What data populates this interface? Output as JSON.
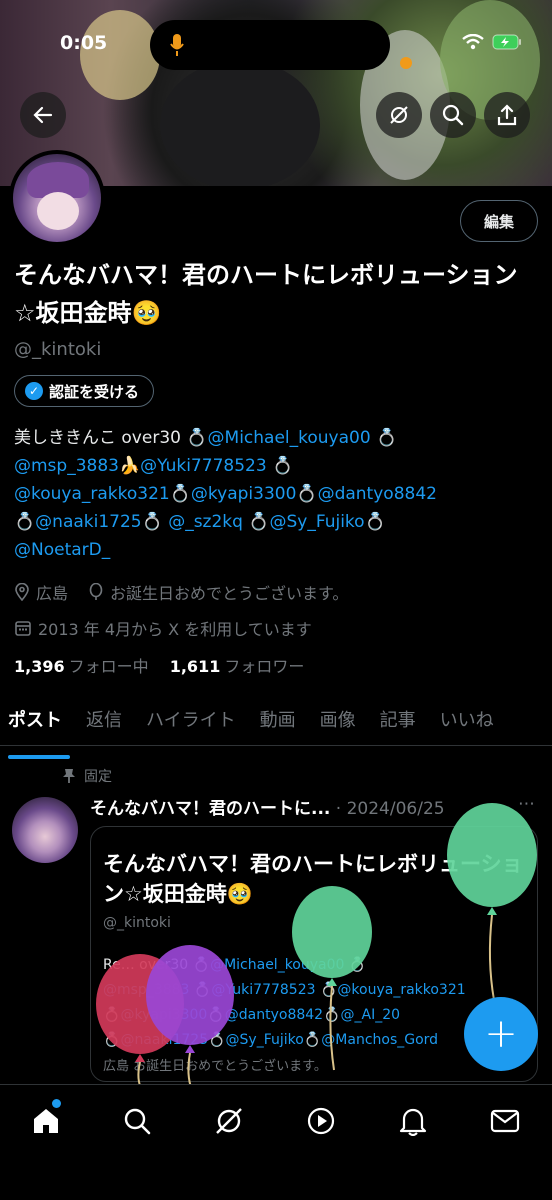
{
  "status_bar": {
    "time": "0:05"
  },
  "profile": {
    "edit_label": "編集",
    "name": "そんなバハマ！君のハートにレボリューション☆坂田金時🥹",
    "handle": "@_kintoki",
    "verify_label": "認証を受ける",
    "bio_lines": [
      [
        {
          "t": "美しききんこ over30 💍",
          "m": false
        },
        {
          "t": "@Michael_kouya00",
          "m": true
        },
        {
          "t": " 💍",
          "m": false
        }
      ],
      [
        {
          "t": "@msp_3883",
          "m": true
        },
        {
          "t": "🍌",
          "m": false
        },
        {
          "t": "@Yuki7778523",
          "m": true
        },
        {
          "t": " 💍",
          "m": false
        }
      ],
      [
        {
          "t": "@kouya_rakko321",
          "m": true
        },
        {
          "t": "💍",
          "m": false
        },
        {
          "t": "@kyapi3300",
          "m": true
        },
        {
          "t": "💍",
          "m": false
        },
        {
          "t": "@dantyo8842",
          "m": true
        }
      ],
      [
        {
          "t": "💍",
          "m": false
        },
        {
          "t": "@naaki1725",
          "m": true
        },
        {
          "t": "💍 ",
          "m": false
        },
        {
          "t": "@_sz2kq",
          "m": true
        },
        {
          "t": " 💍",
          "m": false
        },
        {
          "t": "@Sy_Fujiko",
          "m": true
        },
        {
          "t": "💍",
          "m": false
        }
      ],
      [
        {
          "t": "@NoetarD_",
          "m": true
        }
      ]
    ],
    "location": "広島",
    "birthday": "お誕生日おめでとうございます。",
    "joined": "2013 年 4月から X を利用しています",
    "following_count": "1,396",
    "following_label": "フォロー中",
    "followers_count": "1,611",
    "followers_label": "フォロワー"
  },
  "tabs": [
    {
      "label": "ポスト",
      "active": true
    },
    {
      "label": "返信",
      "active": false
    },
    {
      "label": "ハイライト",
      "active": false
    },
    {
      "label": "動画",
      "active": false
    },
    {
      "label": "画像",
      "active": false
    },
    {
      "label": "記事",
      "active": false
    },
    {
      "label": "いいね",
      "active": false
    }
  ],
  "pinned_post": {
    "pinned_label": "固定",
    "author": "そんなバハマ！君のハートに...",
    "date": "2024/06/25",
    "more": "⋯",
    "card": {
      "title": "そんなバハマ！君のハートにレボリューション☆坂田金時🥹",
      "handle": "@_kintoki",
      "bio_lines": [
        [
          {
            "t": "Re… over30 💍",
            "m": false
          },
          {
            "t": "@Michael_kouya00",
            "m": true
          },
          {
            "t": " 💍",
            "m": false
          }
        ],
        [
          {
            "t": "@msp_3883",
            "m": true
          },
          {
            "t": " 💍",
            "m": false
          },
          {
            "t": "@Yuki7778523",
            "m": true
          },
          {
            "t": " 💍",
            "m": false
          },
          {
            "t": "@kouya_rakko321",
            "m": true
          }
        ],
        [
          {
            "t": "💍",
            "m": false
          },
          {
            "t": "@kyapi3300",
            "m": true
          },
          {
            "t": "💍",
            "m": false
          },
          {
            "t": "@dantyo8842",
            "m": true
          },
          {
            "t": "💍",
            "m": false
          },
          {
            "t": "@_AI_20",
            "m": true
          }
        ],
        [
          {
            "t": "💍",
            "m": false
          },
          {
            "t": "@naaki1725",
            "m": true
          },
          {
            "t": "💍",
            "m": false
          },
          {
            "t": "@Sy_Fujiko",
            "m": true
          },
          {
            "t": "💍",
            "m": false
          },
          {
            "t": "@Manchos_Gord",
            "m": true
          }
        ]
      ],
      "meta": "広島 お誕生日おめでとうございます。"
    }
  },
  "fab_label": "+",
  "colors": {
    "accent": "#1d9bf0",
    "muted": "#71767b",
    "background": "#000000",
    "balloon_green": "#5fd49a",
    "balloon_purple": "#9a46d6",
    "balloon_red": "#d23a5a"
  },
  "bottom_nav": [
    "home-icon",
    "search-icon",
    "grok-icon",
    "video-icon",
    "notifications-icon",
    "messages-icon"
  ]
}
